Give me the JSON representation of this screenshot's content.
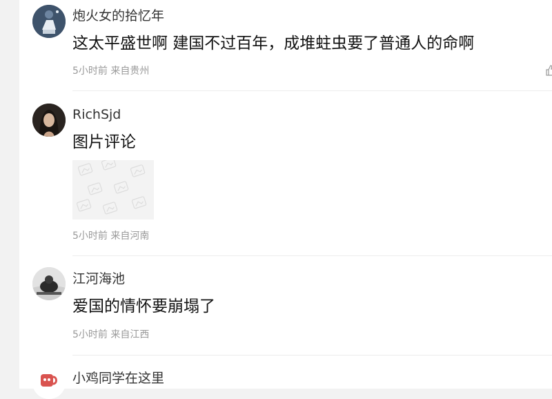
{
  "comments": [
    {
      "username": "炮火女的拾忆年",
      "content": "这太平盛世啊 建国不过百年，成堆蛀虫要了普通人的命啊",
      "time": "5小时前",
      "location": "来自贵州"
    },
    {
      "username": "RichSjd",
      "content": "图片评论",
      "time": "5小时前",
      "location": "来自河南"
    },
    {
      "username": "江河海池",
      "content": "爱国的情怀要崩塌了",
      "time": "5小时前",
      "location": "来自江西"
    },
    {
      "username": "小鸡同学在这里"
    }
  ],
  "icons": {
    "like": "thumbs-up-icon",
    "image_placeholder": "image-placeholder-icon"
  },
  "colors": {
    "username": "#333333",
    "content": "#111111",
    "meta": "#999999",
    "divider": "#ececec",
    "background": "#ffffff"
  }
}
